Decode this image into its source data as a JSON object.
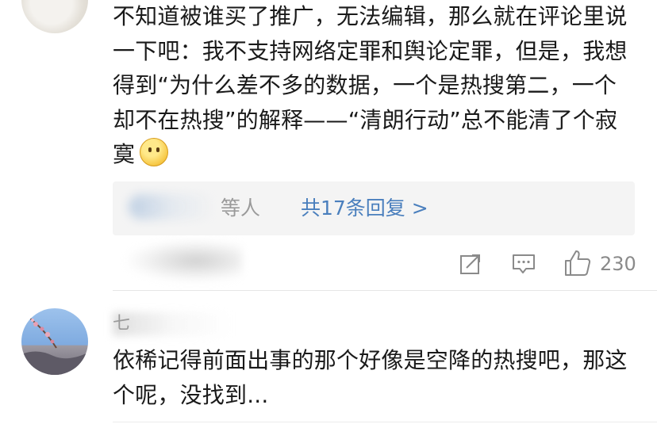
{
  "comment1": {
    "text": "不知道被谁买了推广，无法编辑，那么就在评论里说一下吧：我不支持网络定罪和舆论定罪，但是，我想得到“为什么差不多的数据，一个是热搜第二，一个却不在热搜”的解释——“清朗行动”总不能清了个寂寞",
    "emoji": "thinking-face-icon",
    "reply_preview": {
      "label": "等人",
      "link": "共17条回复 >"
    },
    "actions": {
      "share_icon": "share-icon",
      "comment_icon": "comment-icon",
      "like_icon": "thumbs-up-icon",
      "like_count": "230"
    }
  },
  "comment2": {
    "username": "七",
    "text": "依稀记得前面出事的那个好像是空降的热搜吧，那这个呢，没找到..."
  },
  "colors": {
    "link": "#4a7fbd",
    "muted": "#9a9a9a",
    "reply_bg": "#f4f4f4"
  }
}
